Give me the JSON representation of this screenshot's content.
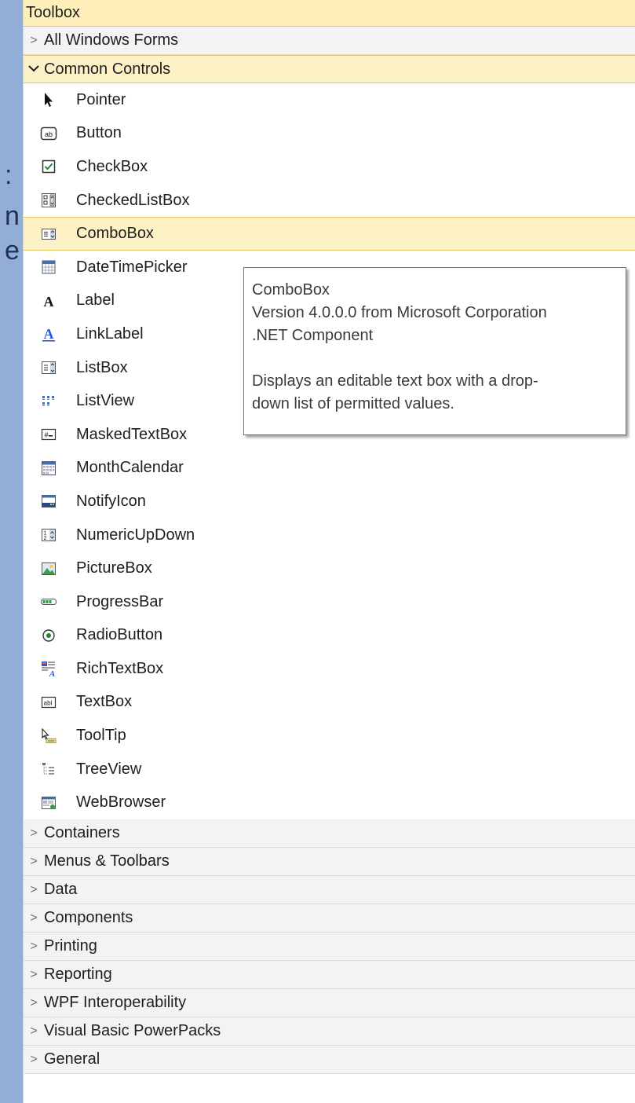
{
  "background_glyphs": [
    ":",
    "n",
    "e"
  ],
  "toolbox": {
    "title": "Toolbox",
    "top_tabs": [
      {
        "label": "All Windows Forms",
        "expanded": false
      },
      {
        "label": "Common Controls",
        "expanded": true
      }
    ],
    "items": [
      {
        "label": "Pointer",
        "icon": "pointer-icon"
      },
      {
        "label": "Button",
        "icon": "button-icon"
      },
      {
        "label": "CheckBox",
        "icon": "checkbox-icon"
      },
      {
        "label": "CheckedListBox",
        "icon": "checkedlistbox-icon"
      },
      {
        "label": "ComboBox",
        "icon": "combobox-icon",
        "selected": true
      },
      {
        "label": "DateTimePicker",
        "icon": "datetimepicker-icon"
      },
      {
        "label": "Label",
        "icon": "label-icon"
      },
      {
        "label": "LinkLabel",
        "icon": "linklabel-icon"
      },
      {
        "label": "ListBox",
        "icon": "listbox-icon"
      },
      {
        "label": "ListView",
        "icon": "listview-icon"
      },
      {
        "label": "MaskedTextBox",
        "icon": "maskedtextbox-icon"
      },
      {
        "label": "MonthCalendar",
        "icon": "monthcalendar-icon"
      },
      {
        "label": "NotifyIcon",
        "icon": "notifyicon-icon"
      },
      {
        "label": "NumericUpDown",
        "icon": "numericupdown-icon"
      },
      {
        "label": "PictureBox",
        "icon": "picturebox-icon"
      },
      {
        "label": "ProgressBar",
        "icon": "progressbar-icon"
      },
      {
        "label": "RadioButton",
        "icon": "radiobutton-icon"
      },
      {
        "label": "RichTextBox",
        "icon": "richtextbox-icon"
      },
      {
        "label": "TextBox",
        "icon": "textbox-icon"
      },
      {
        "label": "ToolTip",
        "icon": "tooltip-icon"
      },
      {
        "label": "TreeView",
        "icon": "treeview-icon"
      },
      {
        "label": "WebBrowser",
        "icon": "webbrowser-icon"
      }
    ],
    "bottom_tabs": [
      {
        "label": "Containers"
      },
      {
        "label": "Menus & Toolbars"
      },
      {
        "label": "Data"
      },
      {
        "label": "Components"
      },
      {
        "label": "Printing"
      },
      {
        "label": "Reporting"
      },
      {
        "label": "WPF Interoperability"
      },
      {
        "label": "Visual Basic PowerPacks"
      },
      {
        "label": "General"
      }
    ]
  },
  "tooltip": {
    "title": "ComboBox",
    "version": "Version 4.0.0.0 from Microsoft Corporation",
    "kind": ".NET Component",
    "description_line1": "Displays an editable text box with a drop-",
    "description_line2": "down list of permitted values."
  },
  "colors": {
    "selection": "#fdf2c6",
    "selection_border": "#e5c365",
    "tab_header": "#f3f3f3",
    "background": "#93aed6"
  }
}
